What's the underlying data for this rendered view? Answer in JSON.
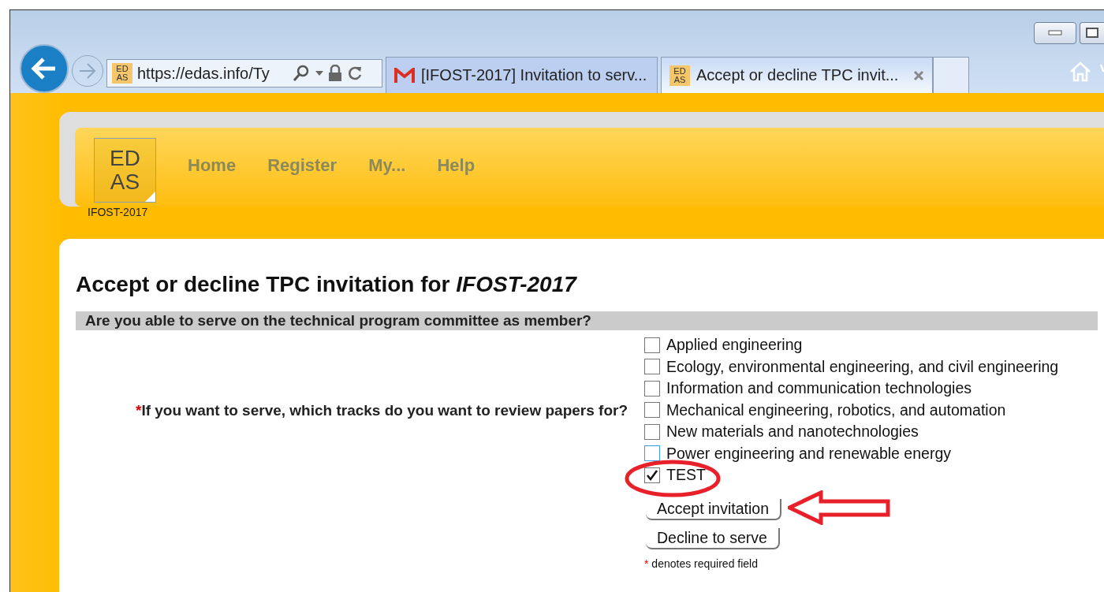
{
  "browser": {
    "address_icon": [
      "ED",
      "AS"
    ],
    "address": "https://edas.info/Ty",
    "tabs": [
      {
        "kind": "mail",
        "title": "[IFOST-2017] Invitation to serv...",
        "selected": false,
        "closable": false
      },
      {
        "kind": "site",
        "icon": [
          "ED",
          "AS"
        ],
        "title": "Accept or decline TPC invit...",
        "selected": true,
        "closable": true
      }
    ]
  },
  "site": {
    "logo": [
      "ED",
      "AS"
    ],
    "nav": [
      "Home",
      "Register",
      "My...",
      "Help"
    ],
    "conference": "IFOST-2017"
  },
  "page": {
    "title": "Accept or decline TPC invitation for *IFOST-2017*",
    "section": "Are you able to serve on the technical program committee as member?",
    "required_mark": "*",
    "question": "If you want to serve, which tracks do you want to review papers for?",
    "tracks": [
      {
        "label": "Applied engineering",
        "checked": false,
        "hovered": false
      },
      {
        "label": "Ecology, environmental engineering, and civil engineering",
        "checked": false,
        "hovered": false
      },
      {
        "label": "Information and communication technologies",
        "checked": false,
        "hovered": false
      },
      {
        "label": "Mechanical engineering, robotics, and automation",
        "checked": false,
        "hovered": false
      },
      {
        "label": "New materials and nanotechnologies",
        "checked": false,
        "hovered": false
      },
      {
        "label": "Power engineering and renewable energy",
        "checked": false,
        "hovered": true
      },
      {
        "label": "TEST",
        "checked": true,
        "hovered": false
      }
    ],
    "buttons": [
      "Accept invitation",
      "Decline to serve"
    ],
    "note_mark": "*",
    "note": " denotes required field"
  }
}
